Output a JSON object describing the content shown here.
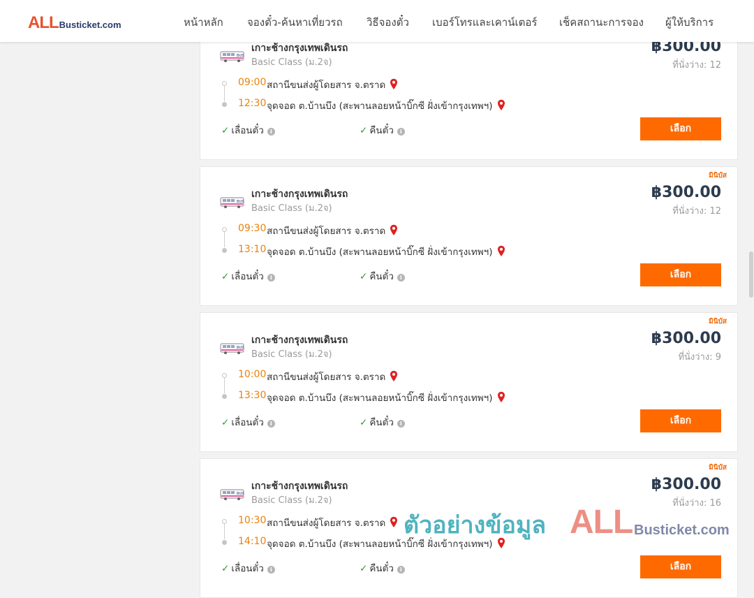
{
  "header": {
    "logo": {
      "part1": "ALL",
      "part2": "Busticket.com"
    },
    "nav": [
      "หน้าหลัก",
      "จองตั๋ว-ค้นหาเที่ยวรถ",
      "วิธีจองตั๋ว",
      "เบอร์โทรและเคาน์เตอร์",
      "เช็คสถานะการจอง",
      "ผู้ให้บริการ"
    ]
  },
  "trips": [
    {
      "badge": "",
      "operator": "เกาะช้างกรุงเทพเดินรถ",
      "class": "Basic Class (ม.2จ)",
      "price": "฿300.00",
      "seats": "ที่นั่งว่าง: 12",
      "depart_time": "09:00",
      "depart_station": "สถานีขนส่งผู้โดยสาร จ.ตราด",
      "arrive_time": "12:30",
      "arrive_station": "จุดจอด ต.บ้านบึง (สะพานลอยหน้าบิ๊กซี ฝั่งเข้ากรุงเทพฯ)",
      "reschedule": "เลื่อนตั๋ว",
      "refund": "คืนตั๋ว",
      "select": "เลือก"
    },
    {
      "badge": "มินิบัส",
      "operator": "เกาะช้างกรุงเทพเดินรถ",
      "class": "Basic Class (ม.2จ)",
      "price": "฿300.00",
      "seats": "ที่นั่งว่าง: 12",
      "depart_time": "09:30",
      "depart_station": "สถานีขนส่งผู้โดยสาร จ.ตราด",
      "arrive_time": "13:10",
      "arrive_station": "จุดจอด ต.บ้านบึง (สะพานลอยหน้าบิ๊กซี ฝั่งเข้ากรุงเทพฯ)",
      "reschedule": "เลื่อนตั๋ว",
      "refund": "คืนตั๋ว",
      "select": "เลือก"
    },
    {
      "badge": "มินิบัส",
      "operator": "เกาะช้างกรุงเทพเดินรถ",
      "class": "Basic Class (ม.2จ)",
      "price": "฿300.00",
      "seats": "ที่นั่งว่าง: 9",
      "depart_time": "10:00",
      "depart_station": "สถานีขนส่งผู้โดยสาร จ.ตราด",
      "arrive_time": "13:30",
      "arrive_station": "จุดจอด ต.บ้านบึง (สะพานลอยหน้าบิ๊กซี ฝั่งเข้ากรุงเทพฯ)",
      "reschedule": "เลื่อนตั๋ว",
      "refund": "คืนตั๋ว",
      "select": "เลือก"
    },
    {
      "badge": "มินิบัส",
      "operator": "เกาะช้างกรุงเทพเดินรถ",
      "class": "Basic Class (ม.2จ)",
      "price": "฿300.00",
      "seats": "ที่นั่งว่าง: 16",
      "depart_time": "10:30",
      "depart_station": "สถานีขนส่งผู้โดยสาร จ.ตราด",
      "arrive_time": "14:10",
      "arrive_station": "จุดจอด ต.บ้านบึง (สะพานลอยหน้าบิ๊กซี ฝั่งเข้ากรุงเทพฯ)",
      "reschedule": "เลื่อนตั๋ว",
      "refund": "คืนตั๋ว",
      "select": "เลือก"
    }
  ],
  "watermark": {
    "text": "ตัวอย่างข้อมูล",
    "brand1": "ALL",
    "brand2": "Busticket.com"
  },
  "colors": {
    "accent": "#ff6a00",
    "time": "#e8820c",
    "check": "#2e9a3a",
    "pin": "#e02020",
    "price": "#2d3b4f"
  }
}
